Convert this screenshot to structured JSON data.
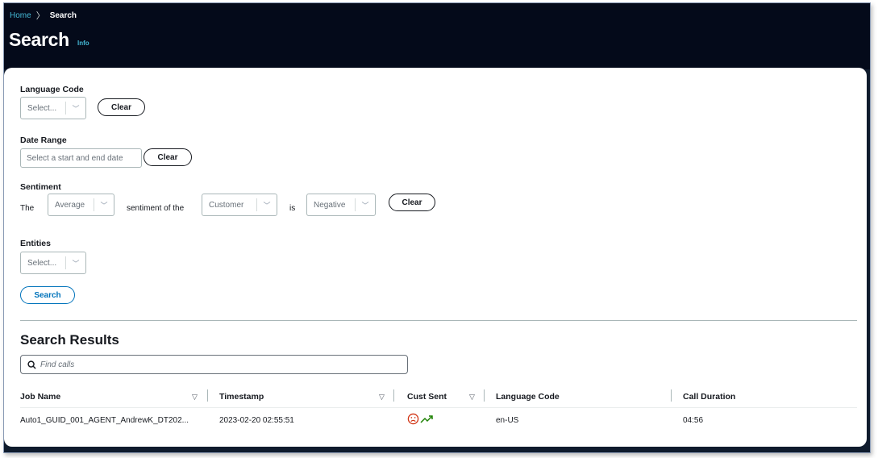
{
  "breadcrumb": {
    "home": "Home",
    "separator": "〉",
    "current": "Search"
  },
  "page": {
    "title": "Search",
    "info": "Info"
  },
  "filters": {
    "language_code": {
      "label": "Language Code",
      "placeholder": "Select...",
      "clear": "Clear"
    },
    "date_range": {
      "label": "Date Range",
      "placeholder": "Select a start and end date",
      "clear": "Clear"
    },
    "sentiment": {
      "label": "Sentiment",
      "prefix": "The",
      "aggregate": "Average",
      "middle": "sentiment of the",
      "participant": "Customer",
      "is": "is",
      "polarity": "Negative",
      "clear": "Clear"
    },
    "entities": {
      "label": "Entities",
      "placeholder": "Select..."
    },
    "search_button": "Search"
  },
  "results": {
    "title": "Search Results",
    "find_placeholder": "Find calls",
    "columns": [
      "Job Name",
      "Timestamp",
      "Cust Sent",
      "Language Code",
      "Call Duration"
    ],
    "rows": [
      {
        "job_name": "Auto1_GUID_001_AGENT_AndrewK_DT202...",
        "timestamp": "2023-02-20 02:55:51",
        "cust_sent_icons": [
          "sad-face-icon",
          "trend-up-icon"
        ],
        "language_code": "en-US",
        "call_duration": "04:56"
      }
    ]
  },
  "colors": {
    "header_bg": "#040a1a",
    "link": "#44b9d6",
    "primary": "#0073bb",
    "negative": "#d13212",
    "positive": "#1d8102"
  }
}
